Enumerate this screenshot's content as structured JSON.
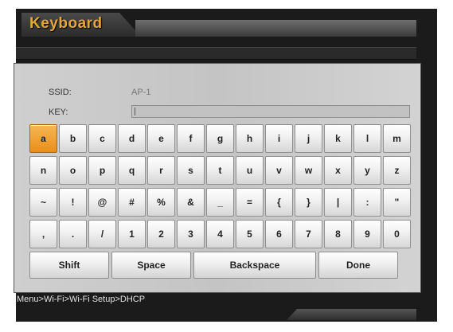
{
  "header": {
    "title": "Keyboard"
  },
  "form": {
    "ssid_label": "SSID:",
    "ssid_value": "AP-1",
    "key_label": "KEY:",
    "key_value": ""
  },
  "keyboard": {
    "rows": [
      [
        "a",
        "b",
        "c",
        "d",
        "e",
        "f",
        "g",
        "h",
        "i",
        "j",
        "k",
        "l",
        "m"
      ],
      [
        "n",
        "o",
        "p",
        "q",
        "r",
        "s",
        "t",
        "u",
        "v",
        "w",
        "x",
        "y",
        "z"
      ],
      [
        "~",
        "!",
        "@",
        "#",
        "%",
        "&",
        "_",
        "=",
        "{",
        "}",
        "|",
        ":",
        "\""
      ],
      [
        ",",
        ".",
        "/",
        "1",
        "2",
        "3",
        "4",
        "5",
        "6",
        "7",
        "8",
        "9",
        "0"
      ]
    ],
    "selected_key": "a",
    "shift_label": "Shift",
    "space_label": "Space",
    "backspace_label": "Backspace",
    "done_label": "Done"
  },
  "footer": {
    "breadcrumb": "Menu>Wi-Fi>Wi-Fi Setup>DHCP"
  },
  "colors": {
    "accent": "#e7a63a",
    "selected_key": "#ee9a26"
  }
}
